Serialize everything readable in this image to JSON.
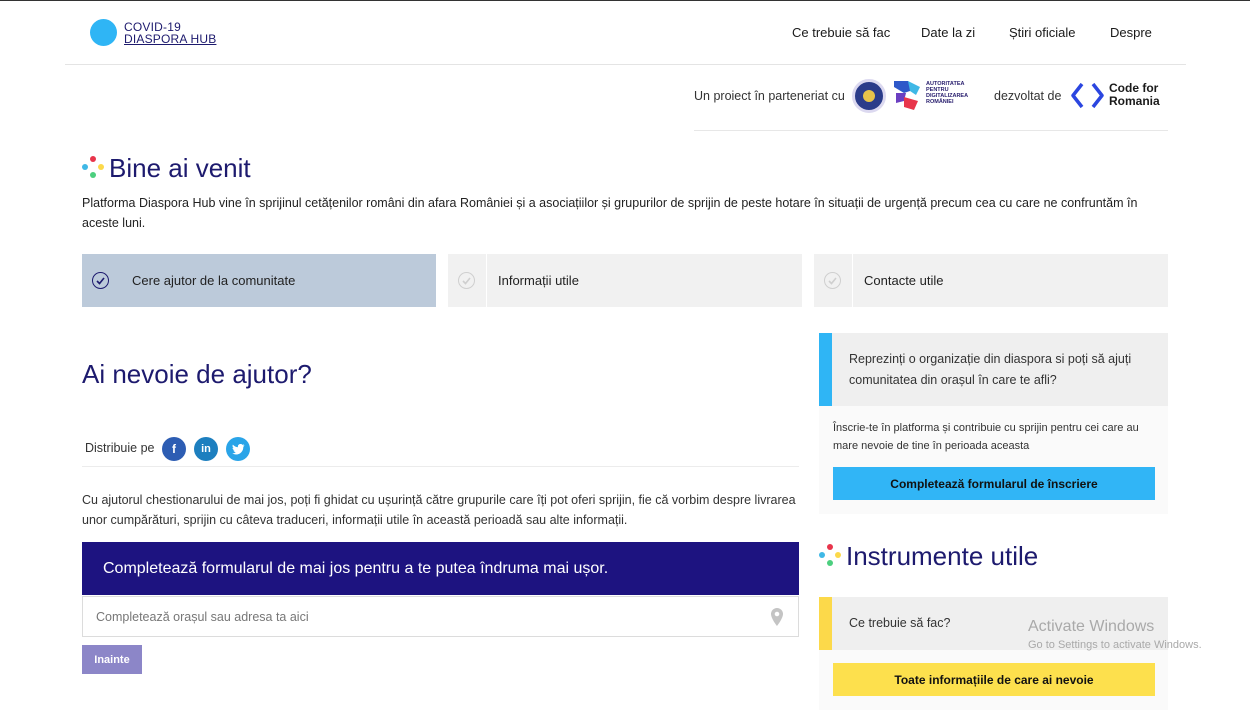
{
  "header": {
    "logo_line1": "COVID-19",
    "logo_line2": "DIASPORA HUB",
    "nav": [
      "Ce trebuie să fac",
      "Date la zi",
      "Știri oficiale",
      "Despre"
    ]
  },
  "partners": {
    "partnership_text": "Un proiect în parteneriat cu",
    "adr_logo_text": "AUTORITATEA PENTRU DIGITALIZAREA ROMÂNIEI",
    "developed_text": "dezvoltat de",
    "cfr_logo_text": "Code for Romania"
  },
  "welcome": {
    "title": "Bine ai venit",
    "intro": "Platforma Diaspora Hub vine în sprijinul cetățenilor români din afara României și a asociațiilor și grupurilor de sprijin de peste hotare în situații de urgență precum cea cu care ne confruntăm în aceste luni."
  },
  "tabs": [
    {
      "label": "Cere ajutor de la comunitate",
      "active": true
    },
    {
      "label": "Informații utile",
      "active": false
    },
    {
      "label": "Contacte utile",
      "active": false
    }
  ],
  "help": {
    "title": "Ai nevoie de ajutor?",
    "share_label": "Distribuie pe",
    "social": [
      "facebook-icon",
      "linkedin-icon",
      "twitter-icon"
    ],
    "text": "Cu ajutorul chestionarului de mai jos, poți fi ghidat cu ușurință către grupurile care îți pot oferi sprijin, fie că vorbim despre livrarea unor cumpărături, sprijin cu câteva traduceri, informații utile în această perioadă sau alte informații.",
    "banner": "Completează formularul de mai jos pentru a te putea îndruma mai ușor.",
    "address_placeholder": "Completează orașul sau adresa ta aici",
    "next_button": "Inainte"
  },
  "org_card": {
    "question": "Reprezinți o organizație din diaspora si poți să ajuți comunitatea din orașul în care te afli?",
    "subtext": "Înscrie-te în platforma și contribuie cu sprijin pentru cei care au mare nevoie de tine în perioada aceasta",
    "button": "Completează formularul de înscriere"
  },
  "tools": {
    "title": "Instrumente utile",
    "question": "Ce trebuie să fac?",
    "button": "Toate informațiile de care ai nevoie"
  },
  "watermark": {
    "line1": "Activate Windows",
    "line2": "Go to Settings to activate Windows."
  },
  "colors": {
    "brand_navy": "#1d1a6e",
    "banner_navy": "#1d1380",
    "accent_blue": "#31b5f6",
    "accent_yellow": "#fde04d",
    "active_tab": "#bccada"
  }
}
